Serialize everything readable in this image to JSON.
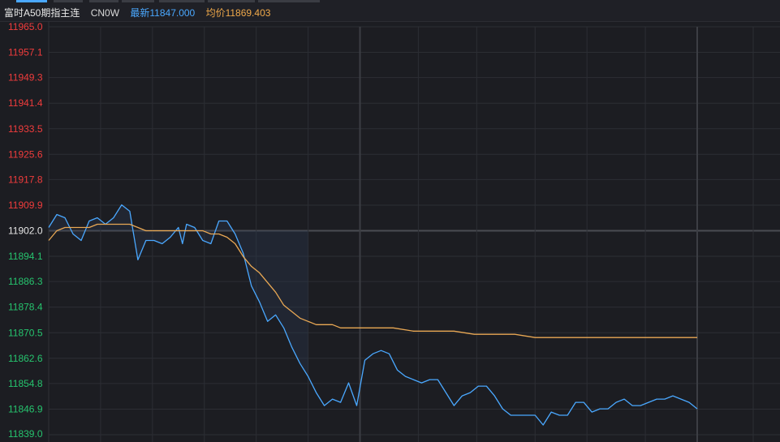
{
  "header": {
    "instrument_name": "富时A50期指主连",
    "code": "CN0W",
    "latest_label": "最新11847.000",
    "average_label": "均价11869.403"
  },
  "colors": {
    "background": "#1c1d22",
    "grid": "#2c2e34",
    "up": "#f03c3c",
    "down": "#26c46e",
    "neutral": "#e6e6e6",
    "price_line": "#4aa8ff",
    "avg_line": "#e9a854",
    "area_fill": "#2a3a50"
  },
  "chart_data": {
    "type": "line",
    "reference_price": 11902.0,
    "ylim": [
      11839.0,
      11965.0
    ],
    "y_ticks": [
      "11965.0",
      "11957.1",
      "11949.3",
      "11941.4",
      "11933.5",
      "11925.6",
      "11917.8",
      "11909.9",
      "11902.0",
      "11894.1",
      "11886.3",
      "11878.4",
      "11870.5",
      "11862.6",
      "11854.8",
      "11846.9",
      "11839.0"
    ],
    "x_range": [
      0,
      320
    ],
    "series": [
      {
        "x": [
          0,
          4,
          8,
          12,
          16,
          20,
          24,
          28,
          32,
          36,
          40,
          44,
          48,
          52,
          56,
          60,
          64,
          66,
          68,
          72,
          76,
          80,
          84,
          88,
          92,
          96,
          100,
          104,
          108,
          112,
          116,
          120,
          124,
          128,
          132,
          136,
          140,
          144,
          148,
          152,
          156,
          160,
          164,
          168,
          172,
          176,
          180,
          184,
          188,
          192,
          196,
          200,
          204,
          208,
          212,
          216,
          220,
          224,
          228,
          232,
          236,
          240,
          244,
          248,
          252,
          256,
          260,
          264,
          268,
          272,
          276,
          280,
          284,
          288,
          292,
          296,
          300,
          304,
          308,
          312,
          316,
          320
        ],
        "y": [
          11903,
          11907,
          11906,
          11901,
          11899,
          11905,
          11906,
          11904,
          11906,
          11910,
          11908,
          11893,
          11899,
          11899,
          11898,
          11900,
          11903,
          11898,
          11904,
          11903,
          11899,
          11898,
          11905,
          11905,
          11901,
          11895,
          11885,
          11880,
          11874,
          11876,
          11872,
          11866,
          11861,
          11857,
          11852,
          11848,
          11850,
          11849,
          11855,
          11848,
          11862,
          11864,
          11865,
          11864,
          11859,
          11857,
          11856,
          11855,
          11856,
          11856,
          11852,
          11848,
          11851,
          11852,
          11854,
          11854,
          11851,
          11847,
          11845,
          11845,
          11845,
          11845,
          11842,
          11846,
          11845,
          11845,
          11849,
          11849,
          11846,
          11847,
          11847,
          11849,
          11850,
          11848,
          11848,
          11849,
          11850,
          11850,
          11851,
          11850,
          11849,
          11847
        ]
      },
      {
        "x": [
          0,
          4,
          8,
          12,
          16,
          20,
          24,
          28,
          32,
          36,
          40,
          44,
          48,
          52,
          56,
          60,
          64,
          68,
          72,
          76,
          80,
          84,
          88,
          92,
          96,
          100,
          104,
          108,
          112,
          116,
          120,
          124,
          128,
          132,
          136,
          140,
          144,
          148,
          152,
          156,
          160,
          170,
          180,
          190,
          200,
          210,
          220,
          230,
          240,
          260,
          280,
          300,
          320
        ],
        "y": [
          11899,
          11902,
          11903,
          11903,
          11903,
          11903,
          11904,
          11904,
          11904,
          11904,
          11904,
          11903,
          11902,
          11902,
          11902,
          11902,
          11902,
          11902,
          11902,
          11902,
          11901,
          11901,
          11900,
          11898,
          11894,
          11891,
          11889,
          11886,
          11883,
          11879,
          11877,
          11875,
          11874,
          11873,
          11873,
          11873,
          11872,
          11872,
          11872,
          11872,
          11872,
          11872,
          11871,
          11871,
          11871,
          11870,
          11870,
          11870,
          11869,
          11869,
          11869,
          11869,
          11869
        ]
      }
    ]
  }
}
